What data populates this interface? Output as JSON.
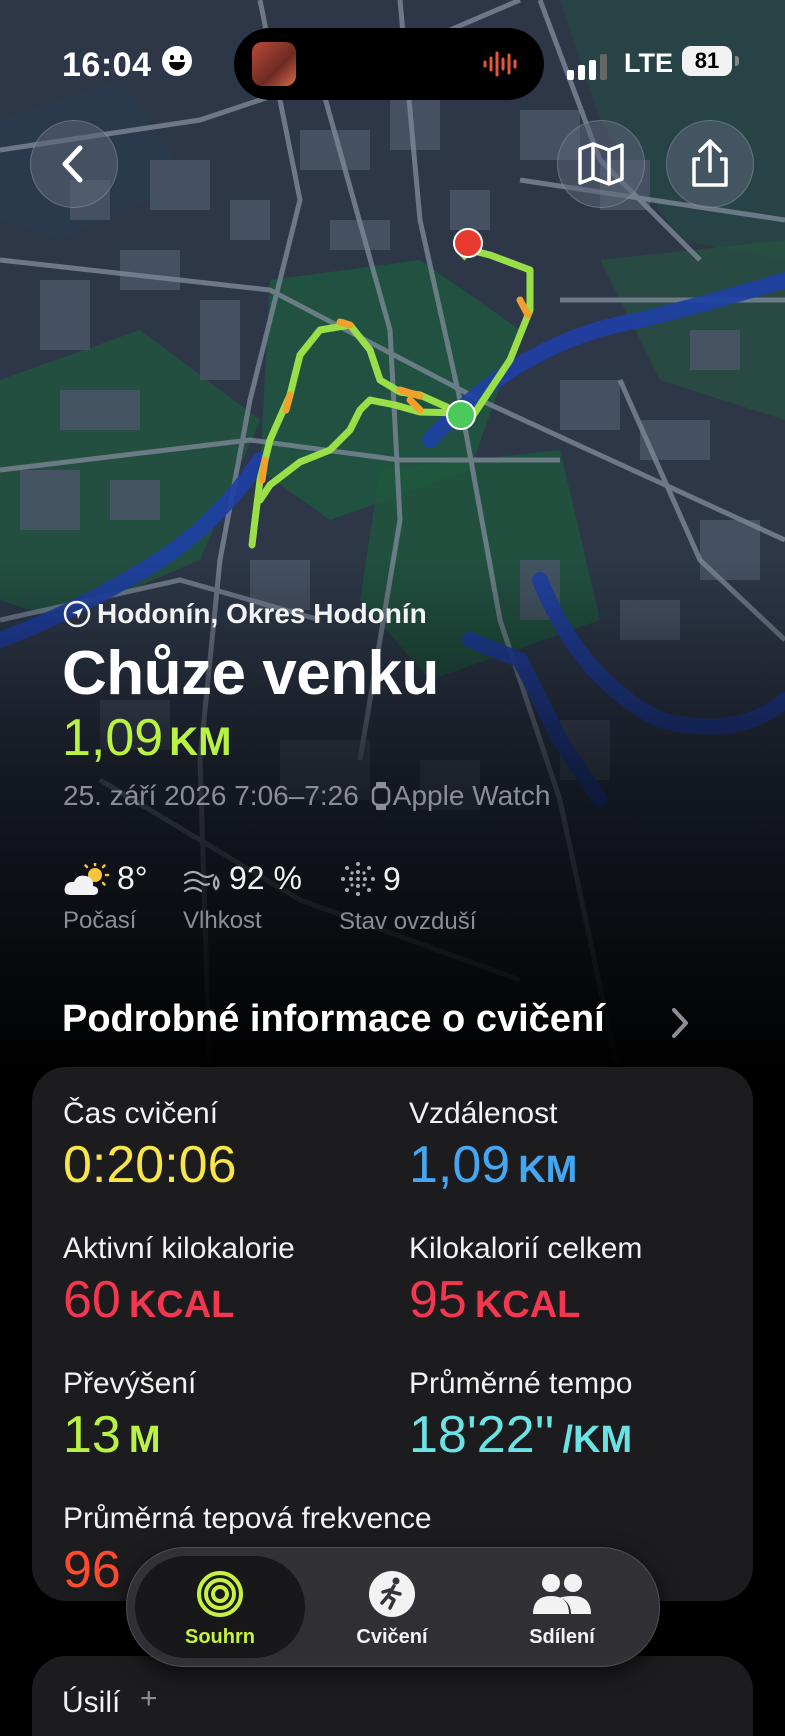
{
  "status_bar": {
    "time": "16:04",
    "network": "LTE",
    "battery": "81"
  },
  "header": {
    "location": "Hodonín, Okres Hodonín",
    "title": "Chůze venku",
    "distance_value": "1,09",
    "distance_unit": "KM",
    "date_range": "25. září 2026 7:06–7:26",
    "device": "Apple Watch"
  },
  "conditions": [
    {
      "value": "8°",
      "label": "Počasí",
      "icon": "partly-sunny-icon"
    },
    {
      "value": "92 %",
      "label": "Vlhkost",
      "icon": "humidity-icon"
    },
    {
      "value": "9",
      "label": "Stav ovzduší",
      "icon": "air-quality-icon"
    }
  ],
  "section_title": "Podrobné informace o cvičení",
  "metrics": [
    {
      "label": "Čas cvičení",
      "value": "0:20:06",
      "unit": ""
    },
    {
      "label": "Vzdálenost",
      "value": "1,09",
      "unit": "KM"
    },
    {
      "label": "Aktivní kilokalorie",
      "value": "60",
      "unit": "KCAL"
    },
    {
      "label": "Kilokalorií celkem",
      "value": "95",
      "unit": "KCAL"
    },
    {
      "label": "Převýšení",
      "value": "13",
      "unit": "M"
    },
    {
      "label": "Průměrné tempo",
      "value": "18'22''",
      "unit": "/KM"
    },
    {
      "label": "Průměrná tepová frekvence",
      "value": "96",
      "unit": ""
    }
  ],
  "tabs": [
    {
      "label": "Souhrn",
      "icon": "activity-rings-icon",
      "active": true
    },
    {
      "label": "Cvičení",
      "icon": "running-figure-icon",
      "active": false
    },
    {
      "label": "Sdílení",
      "icon": "people-icon",
      "active": false
    }
  ],
  "next_card": {
    "label": "Úsilí",
    "plus": "+"
  },
  "colors": {
    "green": "#b8f243",
    "yellow": "#f8e54a",
    "blue": "#45a7f2",
    "red": "#f2374f",
    "cyan": "#6be2e4",
    "orange": "#ff4a2e"
  }
}
